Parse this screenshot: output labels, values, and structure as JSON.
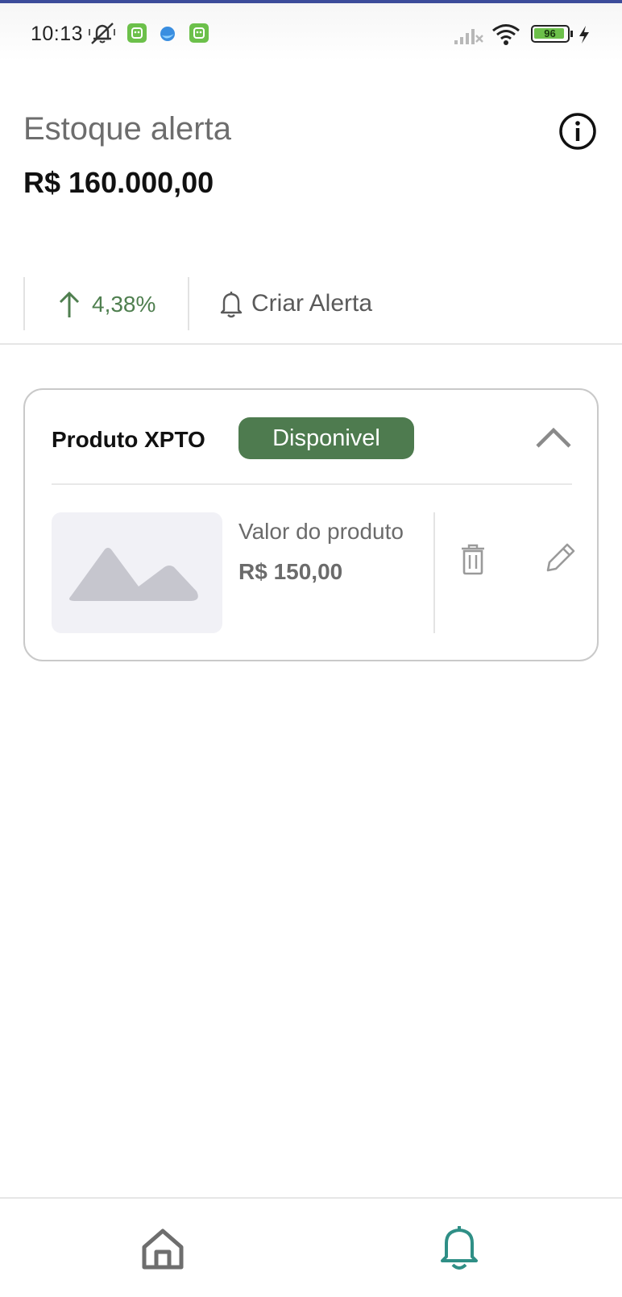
{
  "status_bar": {
    "time": "10:13",
    "battery": "96",
    "icons": [
      "muted-notification-icon",
      "app-notification-icon",
      "browser-icon",
      "app-notification-icon",
      "signal-icon",
      "wifi-icon",
      "battery-icon",
      "charging-icon"
    ]
  },
  "header": {
    "title": "Estoque alerta",
    "total": "R$ 160.000,00",
    "info_icon": "info-icon"
  },
  "stats": {
    "change": "4,38%",
    "change_icon": "arrow-up-icon",
    "create_alert_label": "Criar Alerta",
    "create_alert_icon": "bell-icon",
    "accent_color": "#4f7f4f"
  },
  "product_card": {
    "name": "Produto XPTO",
    "status": "Disponivel",
    "status_color": "#4e7b4f",
    "value_label": "Valor do produto",
    "value": "R$ 150,00",
    "icons": [
      "image-placeholder-icon",
      "trash-icon",
      "pencil-icon",
      "chevron-up-icon"
    ]
  },
  "bottom_nav": {
    "items": [
      {
        "icon": "home-icon",
        "active": false
      },
      {
        "icon": "bell-icon",
        "active": true,
        "color": "#2f8f86"
      }
    ]
  }
}
